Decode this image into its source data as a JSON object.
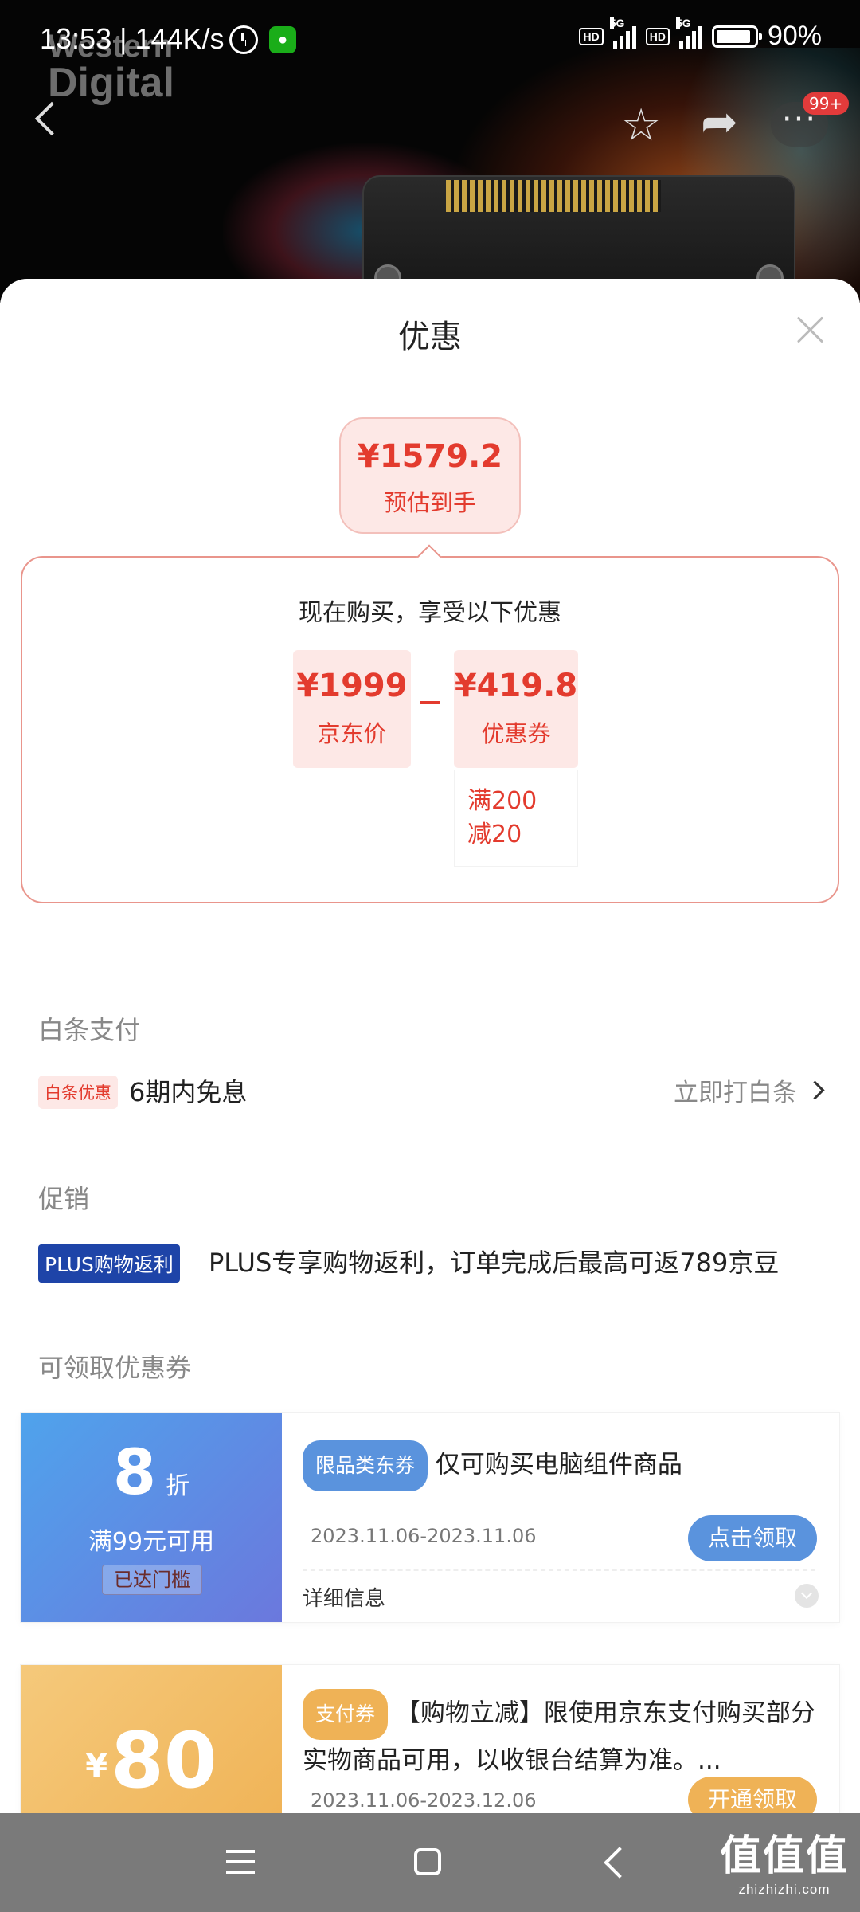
{
  "status_bar": {
    "time": "13:53",
    "speed": "144K/s",
    "battery": "90%"
  },
  "banner": {
    "brand_line1": "Western",
    "brand_line2": "Digital",
    "badge": "99+"
  },
  "sheet": {
    "title": "优惠"
  },
  "estimate": {
    "price": "¥1579.2",
    "label": "预估到手"
  },
  "deal": {
    "heading": "现在购买，享受以下优惠",
    "jd_price": "¥1999",
    "jd_price_label": "京东价",
    "coupon_value": "¥419.8",
    "coupon_label": "优惠券",
    "condition_line1": "满200",
    "condition_line2": "减20"
  },
  "baitiao": {
    "section_title": "白条支付",
    "tag": "白条优惠",
    "text": "6期内免息",
    "link": "立即打白条"
  },
  "promotion": {
    "section_title": "促销",
    "tag": "PLUS购物返利",
    "text": "PLUS专享购物返利，订单完成后最高可返789京豆"
  },
  "coupons": {
    "section_title": "可领取优惠券",
    "items": [
      {
        "value": "8",
        "unit": "折",
        "condition": "满99元可用",
        "status": "已达门槛",
        "tag": "限品类东券",
        "title": "仅可购买电脑组件商品",
        "date": "2023.11.06-2023.11.06",
        "button": "点击领取",
        "detail": "详细信息"
      },
      {
        "currency": "¥",
        "value": "80",
        "tag": "支付券",
        "title": "【购物立减】限使用京东支付购买部分实物商品可用，以收银台结算为准。...",
        "date": "2023.11.06-2023.12.06",
        "button": "开通领取"
      }
    ]
  },
  "watermark": {
    "line1": "值值值",
    "line2": "zhizhizhi.com"
  },
  "colors": {
    "accent_red": "#e33b2e",
    "plus_blue": "#1e44a8",
    "coupon_blue": "#5a93dd",
    "coupon_gold": "#efb256"
  }
}
